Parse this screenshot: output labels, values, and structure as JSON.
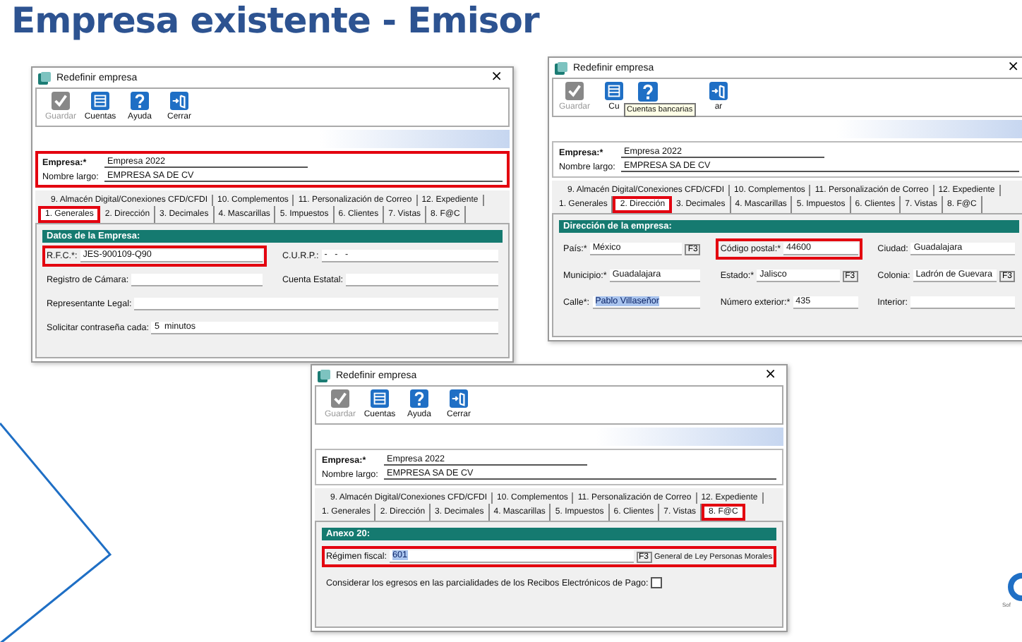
{
  "slide": {
    "title": "Empresa existente - Emisor",
    "logo_text": "Sof"
  },
  "windows": [
    {
      "title": "Redefinir empresa",
      "close": "×",
      "toolbar": [
        {
          "label": "Guardar",
          "kind": "check",
          "disabled": true
        },
        {
          "label": "Cuentas",
          "kind": "list",
          "disabled": false
        },
        {
          "label": "Ayuda",
          "kind": "help",
          "disabled": false
        },
        {
          "label": "Cerrar",
          "kind": "exit",
          "disabled": false
        }
      ],
      "header": {
        "highlighted": true,
        "fields": [
          {
            "label": "Empresa:*",
            "value": "Empresa 2022"
          },
          {
            "label": "Nombre largo:",
            "value": "EMPRESA SA DE CV"
          }
        ]
      },
      "tab_rows": [
        [
          {
            "label": "9. Almacén Digital/Conexiones CFD/CFDI",
            "selected": false,
            "highlighted": false
          },
          {
            "label": "10. Complementos",
            "selected": false,
            "highlighted": false
          },
          {
            "label": "11. Personalización de Correo",
            "selected": false,
            "highlighted": false
          },
          {
            "label": "12. Expediente",
            "selected": false,
            "highlighted": false
          }
        ],
        [
          {
            "label": "1. Generales",
            "selected": true,
            "highlighted": true
          },
          {
            "label": "2. Dirección",
            "selected": false,
            "highlighted": false
          },
          {
            "label": "3. Decimales",
            "selected": false,
            "highlighted": false
          },
          {
            "label": "4. Mascarillas",
            "selected": false,
            "highlighted": false
          },
          {
            "label": "5. Impuestos",
            "selected": false,
            "highlighted": false
          },
          {
            "label": "6. Clientes",
            "selected": false,
            "highlighted": false
          },
          {
            "label": "7. Vistas",
            "selected": false,
            "highlighted": false
          },
          {
            "label": "8. F@C",
            "selected": false,
            "highlighted": false
          }
        ]
      ],
      "section": "Datos de la Empresa:",
      "rows": [
        [
          {
            "kind": "text",
            "label": "R.F.C.*:",
            "value": "JES-900109-Q90",
            "value_selected": false,
            "highlighted": true
          },
          {
            "kind": "text",
            "label": "C.U.R.P.:",
            "value": "-   -   -",
            "value_selected": false,
            "highlighted": false
          }
        ],
        [
          {
            "kind": "text",
            "label": "Registro de Cámara:",
            "highlighted": false
          },
          {
            "kind": "text",
            "label": "Cuenta Estatal:",
            "highlighted": false
          }
        ],
        [
          {
            "kind": "text",
            "label": "Representante Legal:",
            "highlighted": false
          }
        ],
        [
          {
            "kind": "text",
            "label": "Solicitar contraseña cada:",
            "value": "5  minutos",
            "value_selected": false,
            "highlighted": false
          }
        ]
      ]
    },
    {
      "title": "Redefinir empresa",
      "close": "×",
      "toolbar": [
        {
          "label": "Guardar",
          "kind": "check",
          "disabled": true
        },
        {
          "label": "Cu",
          "kind": "list",
          "disabled": false
        },
        {
          "kind": "help",
          "disabled": false
        },
        {
          "label": "ar",
          "kind": "exit",
          "disabled": false
        }
      ],
      "tooltip": "Cuentas bancarias",
      "header": {
        "highlighted": false,
        "fields": [
          {
            "label": "Empresa:*",
            "value": "Empresa 2022"
          },
          {
            "label": "Nombre largo:",
            "value": "EMPRESA SA DE CV"
          }
        ]
      },
      "tab_rows": [
        [
          {
            "label": "9. Almacén Digital/Conexiones CFD/CFDI",
            "selected": false,
            "highlighted": false
          },
          {
            "label": "10. Complementos",
            "selected": false,
            "highlighted": false
          },
          {
            "label": "11. Personalización de Correo",
            "selected": false,
            "highlighted": false
          },
          {
            "label": "12. Expediente",
            "selected": false,
            "highlighted": false
          }
        ],
        [
          {
            "label": "1. Generales",
            "selected": false,
            "highlighted": false
          },
          {
            "label": "2. Dirección",
            "selected": true,
            "highlighted": true
          },
          {
            "label": "3. Decimales",
            "selected": false,
            "highlighted": false
          },
          {
            "label": "4. Mascarillas",
            "selected": false,
            "highlighted": false
          },
          {
            "label": "5. Impuestos",
            "selected": false,
            "highlighted": false
          },
          {
            "label": "6. Clientes",
            "selected": false,
            "highlighted": false
          },
          {
            "label": "7. Vistas",
            "selected": false,
            "highlighted": false
          },
          {
            "label": "8. F@C",
            "selected": false,
            "highlighted": false
          }
        ]
      ],
      "section": "Dirección de la empresa:",
      "rows": [
        [
          {
            "kind": "lookup",
            "label": "País:*",
            "value": "México",
            "button": "F3",
            "value_selected": false,
            "highlighted": false
          },
          {
            "kind": "text",
            "label": "Código postal:*",
            "value": "44600",
            "value_selected": false,
            "highlighted": true
          },
          {
            "kind": "text",
            "label": "Ciudad:",
            "value": "Guadalajara",
            "value_selected": false,
            "highlighted": false
          }
        ],
        [
          {
            "kind": "text",
            "label": "Municipio:*",
            "value": "Guadalajara",
            "value_selected": false,
            "highlighted": false
          },
          {
            "kind": "lookup",
            "label": "Estado:*",
            "value": "Jalisco",
            "button": "F3",
            "value_selected": false,
            "highlighted": false
          },
          {
            "kind": "lookup",
            "label": "Colonia:",
            "value": "Ladrón de Guevara",
            "button": "F3",
            "value_selected": false,
            "highlighted": false
          }
        ],
        [
          {
            "kind": "text",
            "label": "Calle*:",
            "value": "Pablo Villaseñor",
            "value_selected": true,
            "highlighted": false
          },
          {
            "kind": "text",
            "label": "Número exterior:*",
            "value": "435",
            "value_selected": false,
            "highlighted": false
          },
          {
            "kind": "text",
            "label": "Interior:",
            "highlighted": false
          }
        ]
      ]
    },
    {
      "title": "Redefinir empresa",
      "close": "×",
      "toolbar": [
        {
          "label": "Guardar",
          "kind": "check",
          "disabled": true
        },
        {
          "label": "Cuentas",
          "kind": "list",
          "disabled": false
        },
        {
          "label": "Ayuda",
          "kind": "help",
          "disabled": false
        },
        {
          "label": "Cerrar",
          "kind": "exit",
          "disabled": false
        }
      ],
      "header": {
        "highlighted": false,
        "fields": [
          {
            "label": "Empresa:*",
            "value": "Empresa 2022"
          },
          {
            "label": "Nombre largo:",
            "value": "EMPRESA SA DE CV"
          }
        ]
      },
      "tab_rows": [
        [
          {
            "label": "9. Almacén Digital/Conexiones CFD/CFDI",
            "selected": false,
            "highlighted": false
          },
          {
            "label": "10. Complementos",
            "selected": false,
            "highlighted": false
          },
          {
            "label": "11. Personalización de Correo",
            "selected": false,
            "highlighted": false
          },
          {
            "label": "12. Expediente",
            "selected": false,
            "highlighted": false
          }
        ],
        [
          {
            "label": "1. Generales",
            "selected": false,
            "highlighted": false
          },
          {
            "label": "2. Dirección",
            "selected": false,
            "highlighted": false
          },
          {
            "label": "3. Decimales",
            "selected": false,
            "highlighted": false
          },
          {
            "label": "4. Mascarillas",
            "selected": false,
            "highlighted": false
          },
          {
            "label": "5. Impuestos",
            "selected": false,
            "highlighted": false
          },
          {
            "label": "6. Clientes",
            "selected": false,
            "highlighted": false
          },
          {
            "label": "7. Vistas",
            "selected": false,
            "highlighted": false
          },
          {
            "label": "8. F@C",
            "selected": true,
            "highlighted": true
          }
        ]
      ],
      "section": "Anexo 20:",
      "rows": [
        [
          {
            "kind": "lookup",
            "label": "Régimen fiscal:",
            "value": "601",
            "button": "F3",
            "description": "General de Ley Personas Morales",
            "value_selected": true,
            "highlighted": true
          }
        ],
        [
          {
            "kind": "checkbox",
            "label": "Considerar los egresos en las parcialidades de los Recibos Electrónicos de Pago:",
            "checked": false,
            "highlighted": false
          }
        ]
      ]
    }
  ]
}
